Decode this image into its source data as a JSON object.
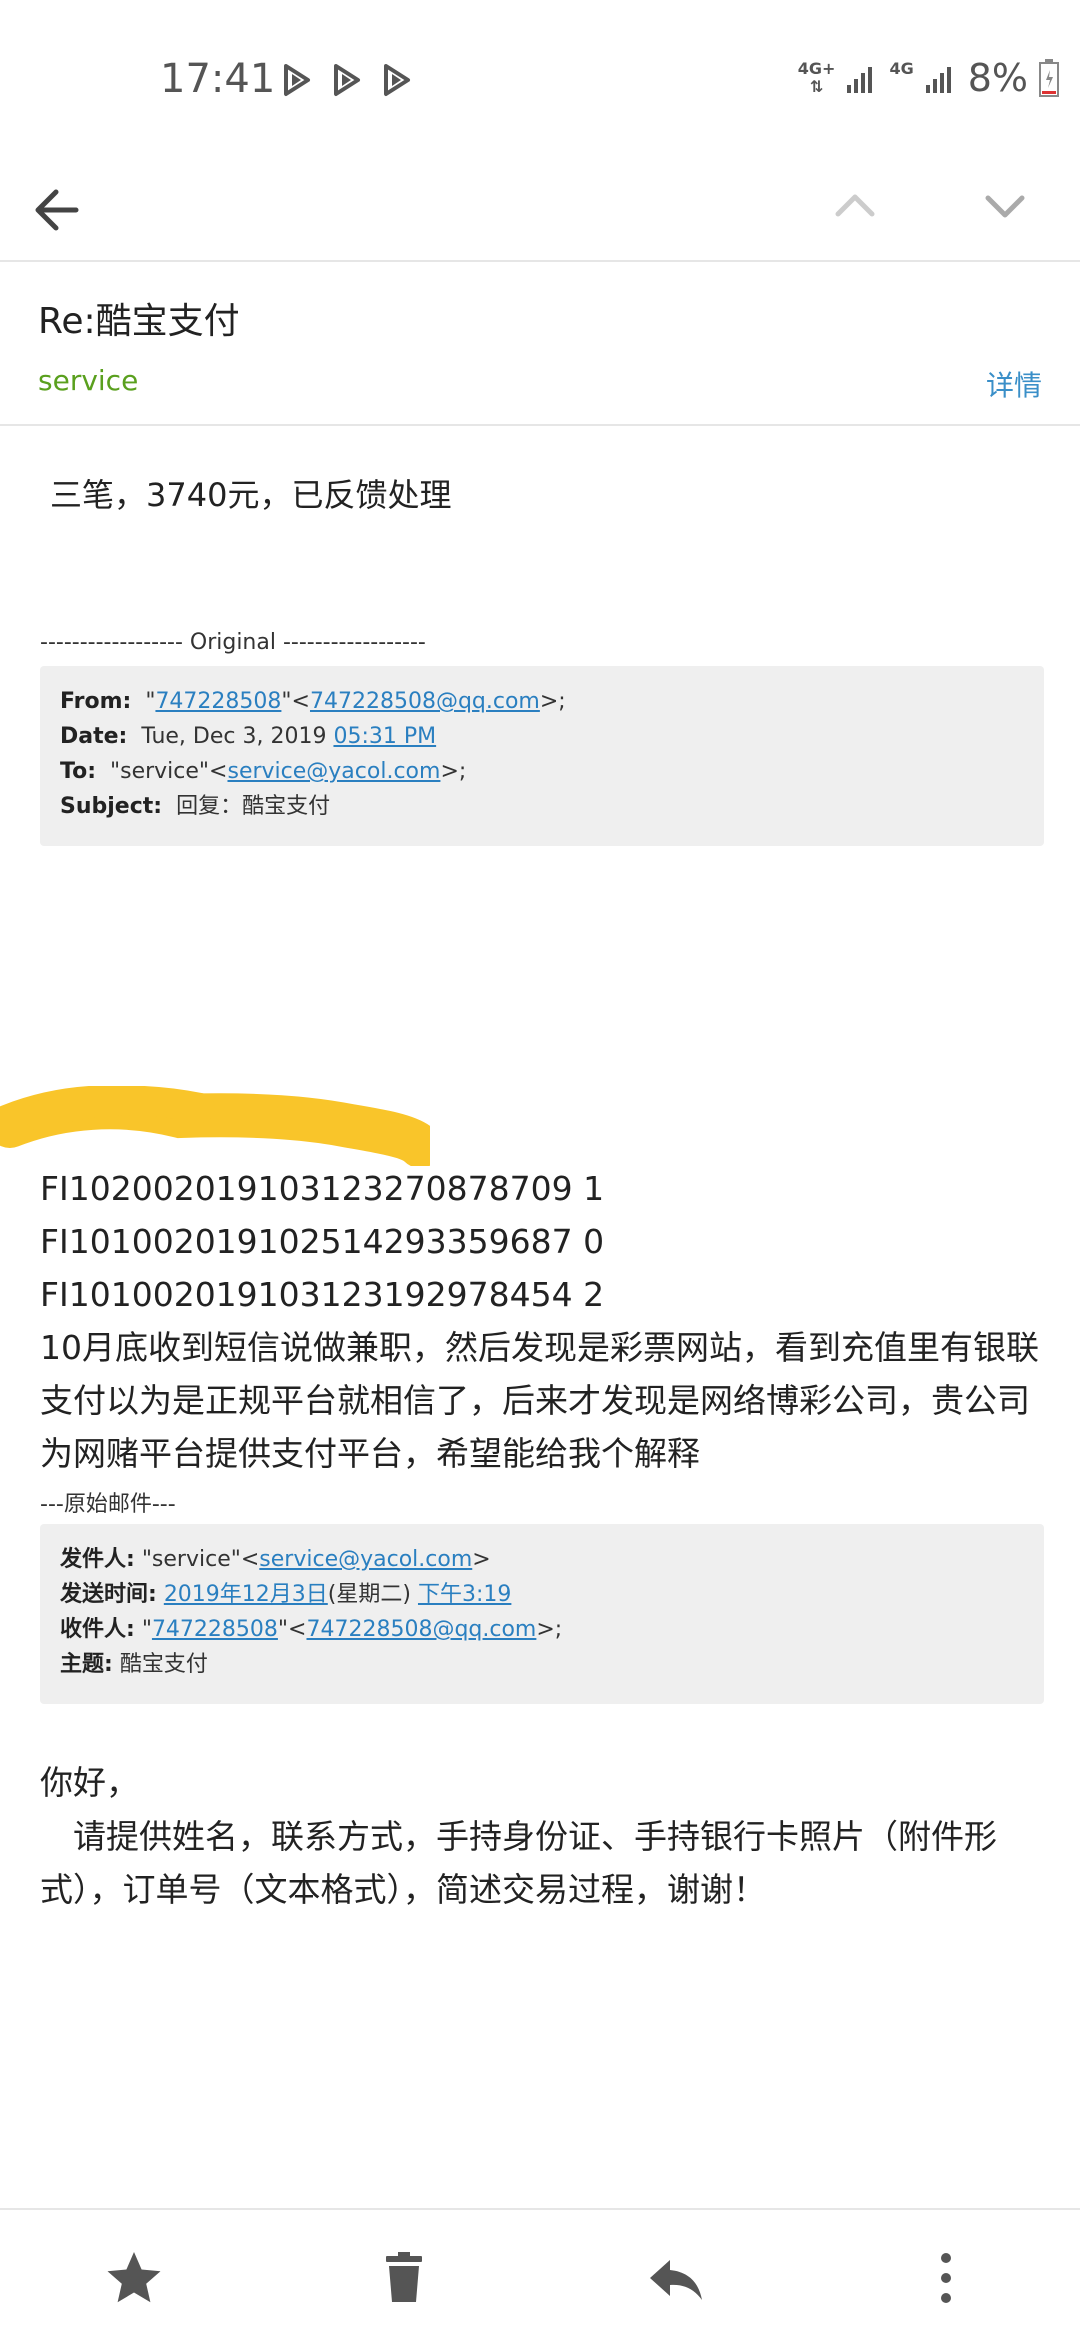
{
  "status_bar": {
    "time": "17:41",
    "net1": "4G+",
    "net2": "4G",
    "battery": "8%"
  },
  "toolbar": {
    "back_icon": "arrow-left-icon",
    "prev_icon": "chevron-up-icon",
    "next_icon": "chevron-down-icon"
  },
  "header": {
    "subject": "Re:酷宝支付",
    "sender": "service",
    "details_label": "详情"
  },
  "body": {
    "reply_text": "三笔，3740元，已反馈处理",
    "original_separator": "------------------ Original ------------------",
    "original": {
      "from_label": "From:",
      "from_name_open": "\"",
      "from_name": "747228508",
      "from_name_close": "\"<",
      "from_email": "747228508@qq.com",
      "from_end": ">;",
      "date_label": "Date:",
      "date_text": "Tue, Dec 3, 2019",
      "date_time": "05:31 PM",
      "to_label": "To:",
      "to_name": "\"service\"<",
      "to_email": "service@yacol.com",
      "to_end": ">;",
      "subject_label": "Subject:",
      "subject_value": "回复：酷宝支付"
    },
    "order_numbers": [
      "FI102002019103123270878709 1",
      "FI101002019102514293359687 0",
      "FI101002019103123192978454 2"
    ],
    "complaint": "10月底收到短信说做兼职，然后发现是彩票网站，看到充值里有银联支付以为是正规平台就相信了，后来才发现是网络博彩公司，贵公司为网赌平台提供支付平台，希望能给我个解释",
    "cn_original_separator": "---原始邮件---",
    "cn_original": {
      "from_label": "发件人:",
      "from_name": "\"service\"<",
      "from_email": "service@yacol.com",
      "from_end": ">",
      "time_label": "发送时间:",
      "time_date": "2019年12月3日",
      "time_weekday": "(星期二)",
      "time_time": "下午3:19",
      "to_label": "收件人:",
      "to_open": "\"",
      "to_name": "747228508",
      "to_mid": "\"<",
      "to_email": "747228508@qq.com",
      "to_end": ">;",
      "subject_label": "主题:",
      "subject_value": "酷宝支付"
    },
    "greeting": "你好，",
    "request": "　请提供姓名，联系方式，手持身份证、手持银行卡照片（附件形式），订单号（文本格式），简述交易过程，谢谢！"
  },
  "bottom_bar": {
    "star_icon": "star-icon",
    "delete_icon": "trash-icon",
    "reply_icon": "reply-icon",
    "more_icon": "more-vertical-icon"
  },
  "colors": {
    "sender_green": "#5aa01e",
    "link_blue": "#2a7fc0",
    "quote_bg": "#efefef",
    "scribble_yellow": "#f9c52a"
  }
}
